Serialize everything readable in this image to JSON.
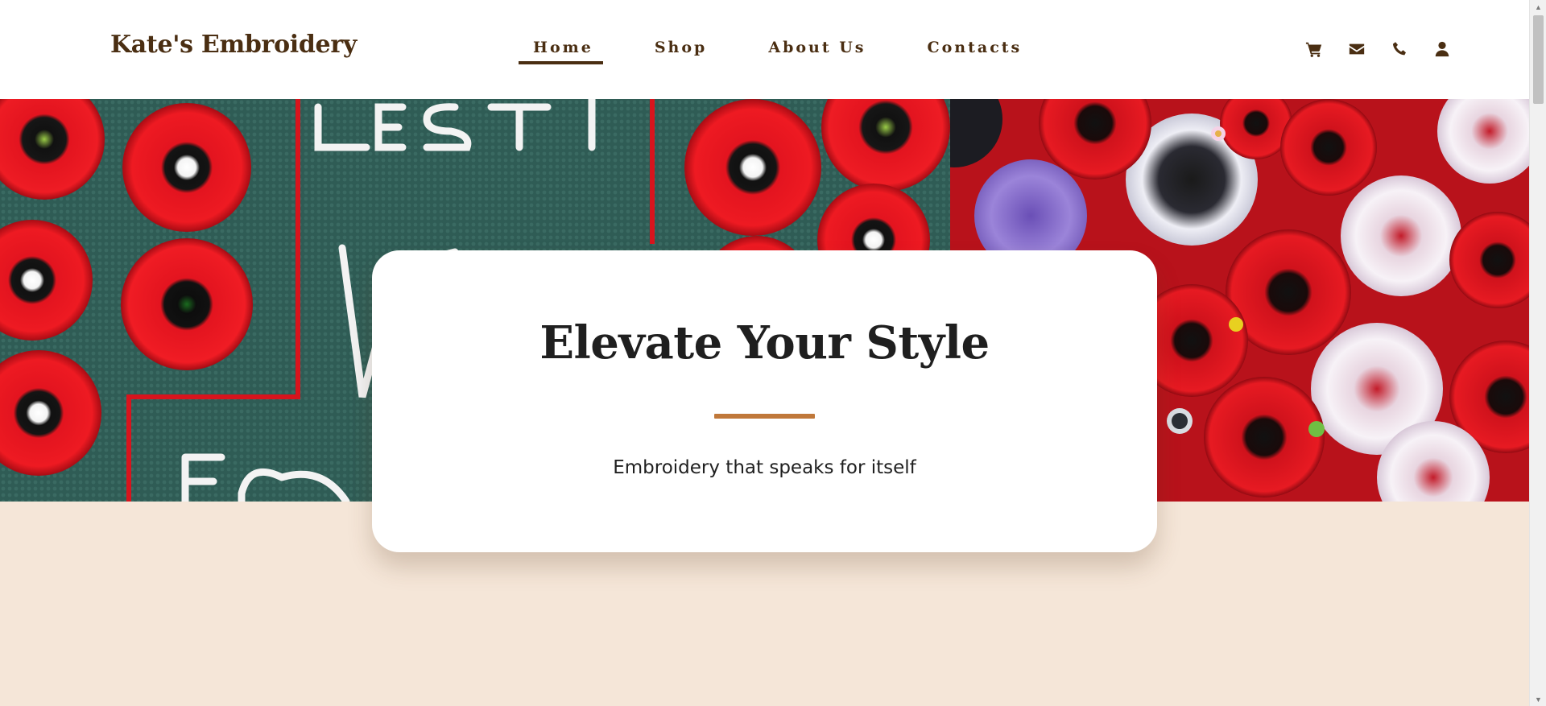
{
  "header": {
    "brand": "Kate's Embroidery",
    "nav": [
      {
        "label": "Home",
        "active": true
      },
      {
        "label": "Shop",
        "active": false
      },
      {
        "label": "About Us",
        "active": false
      },
      {
        "label": "Contacts",
        "active": false
      }
    ],
    "icons": [
      "cart-icon",
      "envelope-icon",
      "phone-icon",
      "user-icon"
    ]
  },
  "hero": {
    "title": "Elevate Your Style",
    "subtitle": "Embroidery that speaks for itself"
  },
  "colors": {
    "brand": "#4a2e12",
    "accent": "#c0783a",
    "page_background": "#f5e6d8",
    "card": "#ffffff"
  }
}
